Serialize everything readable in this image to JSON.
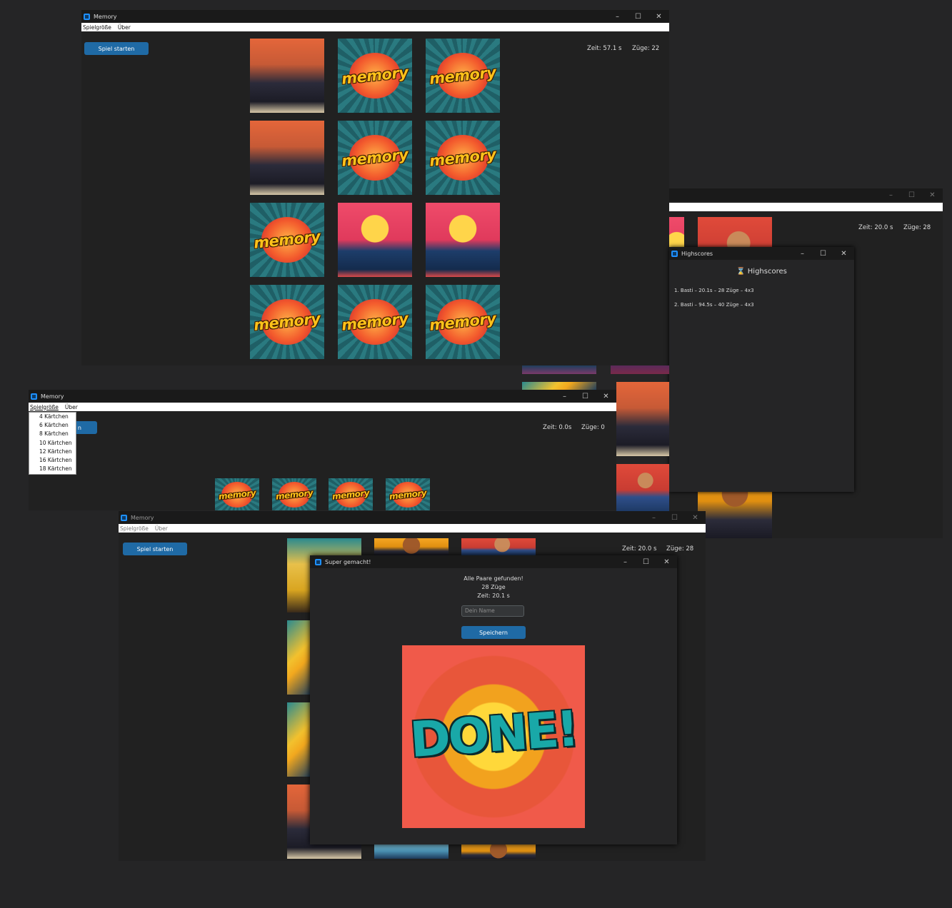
{
  "app": {
    "title": "Memory"
  },
  "menu": {
    "size": "Spielgröße",
    "about": "Über"
  },
  "buttons": {
    "start": "Spiel starten",
    "start_partial": "n",
    "save": "Speichern"
  },
  "window_controls": {
    "minimize": "–",
    "maximize": "☐",
    "close": "✕"
  },
  "win1": {
    "time": "Zeit: 57.1 s",
    "moves": "Züge: 22"
  },
  "win2": {
    "time": "Zeit: 20.0 s",
    "moves": "Züge: 28"
  },
  "win3": {
    "time": "Zeit: 0.0s",
    "moves": "Züge: 0"
  },
  "win4": {
    "time": "Zeit: 20.0 s",
    "moves": "Züge: 28"
  },
  "card_text": "memory",
  "dropdown": {
    "options": [
      "4 Kärtchen",
      "6 Kärtchen",
      "8 Kärtchen",
      "10 Kärtchen",
      "12 Kärtchen",
      "16 Kärtchen",
      "18 Kärtchen"
    ]
  },
  "highscores": {
    "title": "Highscores",
    "heading": "Highscores",
    "entries": [
      "1. Basti – 20.1s – 28 Züge – 4x3",
      "2. Basti – 94.5s – 40 Züge – 4x3"
    ]
  },
  "dialog": {
    "title": "Super gemacht!",
    "line1": "Alle Paare gefunden!",
    "line2": "28 Züge",
    "line3": "Zeit: 20.1 s",
    "name_placeholder": "Dein Name",
    "image_text": "DONE!"
  },
  "colors": {
    "accent": "#1f6aa5",
    "background": "#212121",
    "icon": "#1e90ff"
  }
}
